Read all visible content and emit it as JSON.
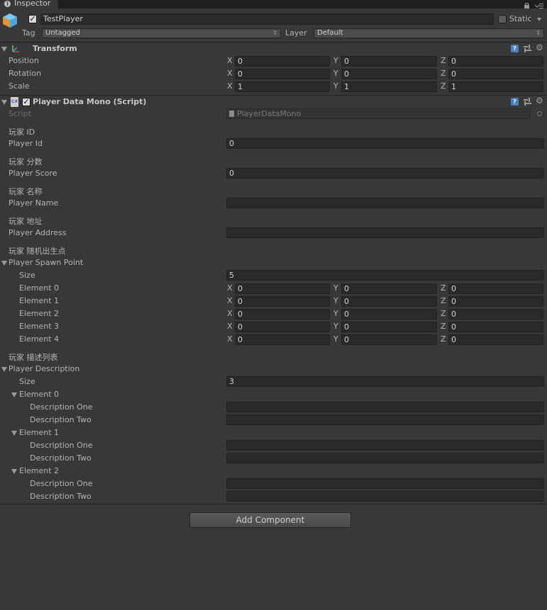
{
  "tab": {
    "title": "Inspector",
    "icon": "info-icon"
  },
  "header": {
    "object_name": "TestPlayer",
    "static_label": "Static",
    "tag_label": "Tag",
    "tag_value": "Untagged",
    "layer_label": "Layer",
    "layer_value": "Default"
  },
  "transform": {
    "title": "Transform",
    "rows": [
      {
        "label": "Position",
        "x": "0",
        "y": "0",
        "z": "0"
      },
      {
        "label": "Rotation",
        "x": "0",
        "y": "0",
        "z": "0"
      },
      {
        "label": "Scale",
        "x": "1",
        "y": "1",
        "z": "1"
      }
    ]
  },
  "axes": {
    "x": "X",
    "y": "Y",
    "z": "Z"
  },
  "script_component": {
    "title": "Player Data Mono (Script)",
    "script_label": "Script",
    "script_value": "PlayerDataMono",
    "id_header": "玩家 ID",
    "id_label": "Player Id",
    "id_value": "0",
    "score_header": "玩家 分数",
    "score_label": "Player Score",
    "score_value": "0",
    "name_header": "玩家 名称",
    "name_label": "Player Name",
    "name_value": "",
    "address_header": "玩家 地址",
    "address_label": "Player Address",
    "address_value": "",
    "spawn_header": "玩家 随机出生点",
    "spawn_label": "Player Spawn Point",
    "spawn_size_label": "Size",
    "spawn_size_value": "5",
    "spawn_elements": [
      {
        "label": "Element 0",
        "x": "0",
        "y": "0",
        "z": "0"
      },
      {
        "label": "Element 1",
        "x": "0",
        "y": "0",
        "z": "0"
      },
      {
        "label": "Element 2",
        "x": "0",
        "y": "0",
        "z": "0"
      },
      {
        "label": "Element 3",
        "x": "0",
        "y": "0",
        "z": "0"
      },
      {
        "label": "Element 4",
        "x": "0",
        "y": "0",
        "z": "0"
      }
    ],
    "desc_header": "玩家 描述列表",
    "desc_label": "Player Description",
    "desc_size_label": "Size",
    "desc_size_value": "3",
    "desc_elements": [
      {
        "label": "Element 0",
        "one_label": "Description One",
        "one_value": "",
        "two_label": "Description Two",
        "two_value": ""
      },
      {
        "label": "Element 1",
        "one_label": "Description One",
        "one_value": "",
        "two_label": "Description Two",
        "two_value": ""
      },
      {
        "label": "Element 2",
        "one_label": "Description One",
        "one_value": "",
        "two_label": "Description Two",
        "two_value": ""
      }
    ]
  },
  "add_component_label": "Add Component",
  "colors": {
    "background": "#383838",
    "field": "#2a2a2a",
    "text": "#b4b4b4"
  }
}
